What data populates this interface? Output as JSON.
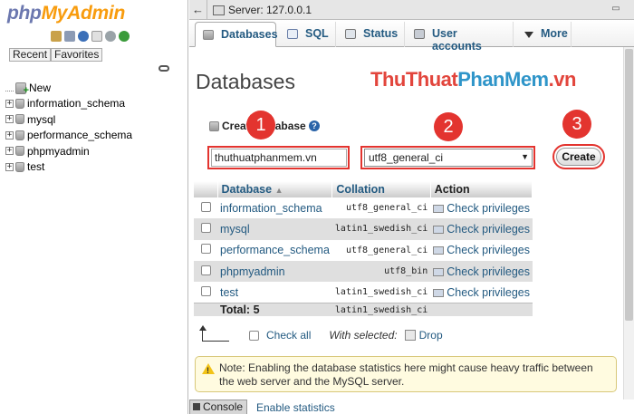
{
  "sidebar": {
    "logo_php": "php",
    "logo_myadmin": "MyAdmin",
    "tab_recent": "Recent",
    "tab_favorites": "Favorites",
    "items": [
      {
        "label": "New"
      },
      {
        "label": "information_schema"
      },
      {
        "label": "mysql"
      },
      {
        "label": "performance_schema"
      },
      {
        "label": "phpmyadmin"
      },
      {
        "label": "test"
      }
    ]
  },
  "topbar": {
    "back": "←",
    "server": "Server: 127.0.0.1",
    "minimize": "▭"
  },
  "tabs": [
    {
      "label": "Databases"
    },
    {
      "label": "SQL"
    },
    {
      "label": "Status"
    },
    {
      "label": "User accounts"
    },
    {
      "label": "More"
    }
  ],
  "page": {
    "title": "Databases",
    "watermark_a": "ThuThuat",
    "watermark_b": "PhanMem",
    "watermark_c": ".vn",
    "create_label": "Create database",
    "db_name_value": "thuthuatphanmem.vn",
    "collation_value": "utf8_general_ci",
    "create_button": "Create",
    "badges": [
      "1",
      "2",
      "3"
    ]
  },
  "table": {
    "headers": {
      "database": "Database",
      "collation": "Collation",
      "action": "Action"
    },
    "rows": [
      {
        "name": "information_schema",
        "collation": "utf8_general_ci",
        "action": "Check privileges"
      },
      {
        "name": "mysql",
        "collation": "latin1_swedish_ci",
        "action": "Check privileges"
      },
      {
        "name": "performance_schema",
        "collation": "utf8_general_ci",
        "action": "Check privileges"
      },
      {
        "name": "phpmyadmin",
        "collation": "utf8_bin",
        "action": "Check privileges"
      },
      {
        "name": "test",
        "collation": "latin1_swedish_ci",
        "action": "Check privileges"
      }
    ],
    "total_label": "Total: 5",
    "total_collation": "latin1_swedish_ci"
  },
  "footer": {
    "check_all": "Check all",
    "with_selected": "With selected:",
    "drop": "Drop"
  },
  "note": {
    "text": "Note: Enabling the database statistics here might cause heavy traffic between the web server and the MySQL server."
  },
  "console": {
    "label": "Console",
    "enable_stats": "Enable statistics"
  },
  "colors": {
    "link": "#235a81",
    "annotation_red": "#e3342f",
    "logo_php": "#6c78af",
    "logo_myadmin": "#f89c0e"
  }
}
